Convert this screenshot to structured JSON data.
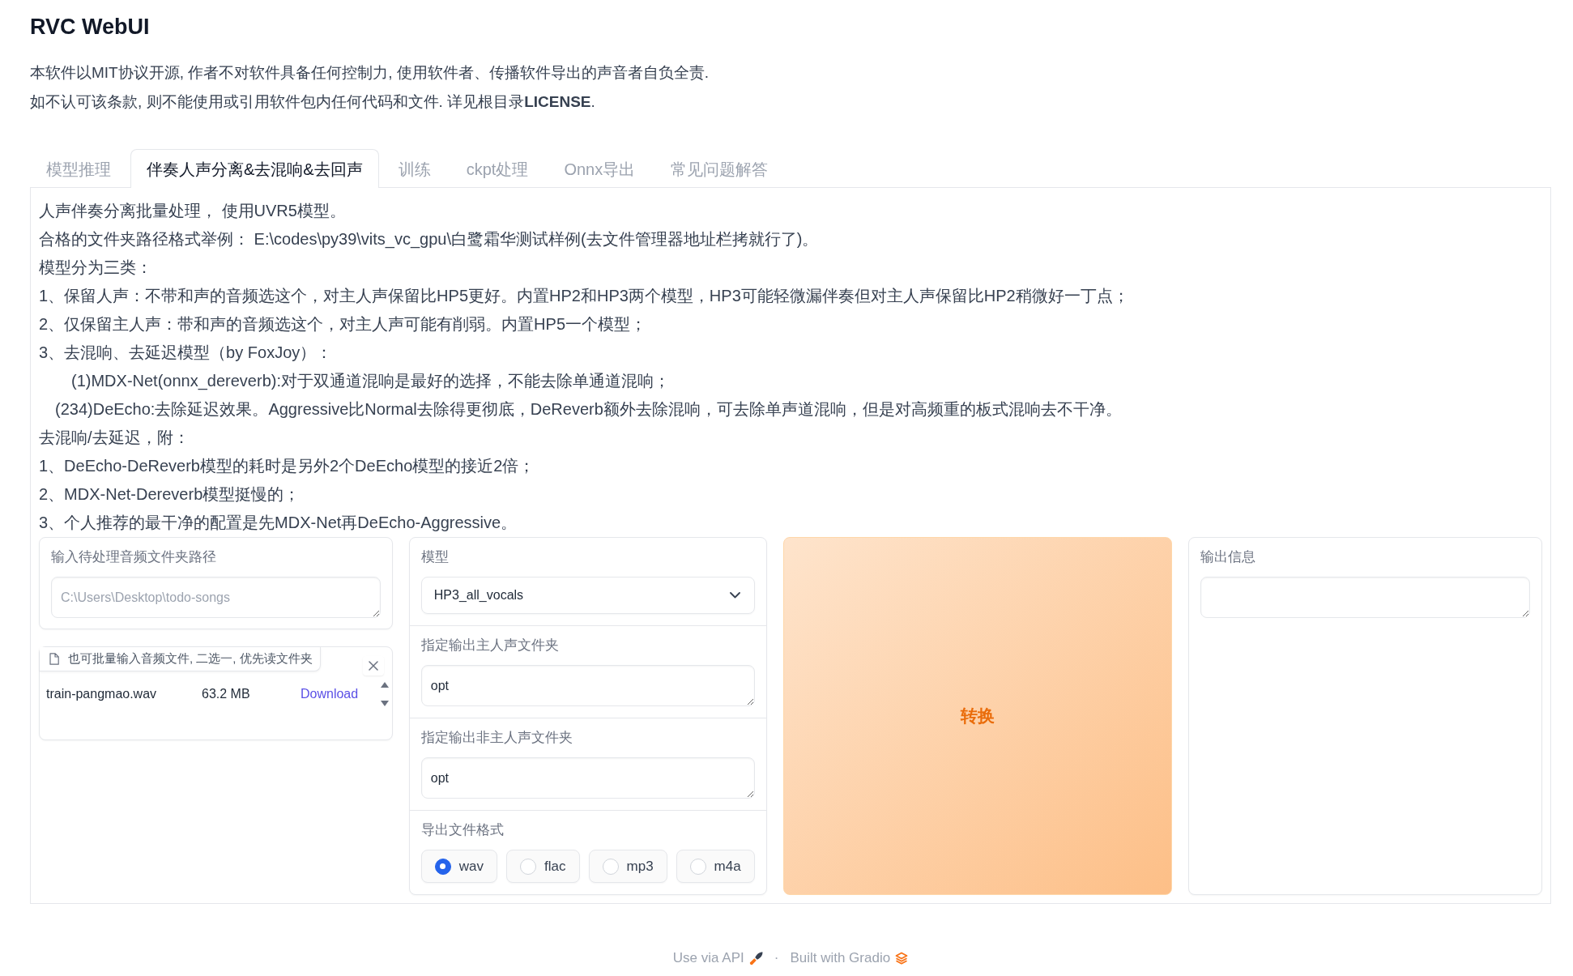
{
  "header": {
    "title": "RVC WebUI",
    "intro": [
      "本软件以MIT协议开源, 作者不对软件具备任何控制力, 使用软件者、传播软件导出的声音者自负全责.",
      "如不认可该条款, 则不能使用或引用软件包内任何代码和文件. 详见根目录**LICENSE**."
    ]
  },
  "tabs": [
    {
      "label": "模型推理",
      "selected": false
    },
    {
      "label": "伴奏人声分离&去混响&去回声",
      "selected": true
    },
    {
      "label": "训练",
      "selected": false
    },
    {
      "label": "ckpt处理",
      "selected": false
    },
    {
      "label": "Onnx导出",
      "selected": false
    },
    {
      "label": "常见问题解答",
      "selected": false
    }
  ],
  "instructions": [
    {
      "kind": "line",
      "text": "人声伴奏分离批量处理， 使用UVR5模型。"
    },
    {
      "kind": "line",
      "text": "合格的文件夹路径格式举例： E:\\codes\\py39\\vits_vc_gpu\\白鹭霜华测试样例(去文件管理器地址栏拷就行了)。"
    },
    {
      "kind": "line",
      "text": "模型分为三类："
    },
    {
      "kind": "line",
      "text": "1、保留人声：不带和声的音频选这个，对主人声保留比HP5更好。内置HP2和HP3两个模型，HP3可能轻微漏伴奏但对主人声保留比HP2稍微好一丁点；"
    },
    {
      "kind": "line",
      "text": "2、仅保留主人声：带和声的音频选这个，对主人声可能有削弱。内置HP5一个模型；"
    },
    {
      "kind": "line",
      "text": "3、去混响、去延迟模型（by FoxJoy）："
    },
    {
      "kind": "indent",
      "text": "(1)MDX-Net(onnx_dereverb):对于双通道混响是最好的选择，不能去除单通道混响；"
    },
    {
      "kind": "halfindent",
      "text": "(234)DeEcho:去除延迟效果。Aggressive比Normal去除得更彻底，DeReverb额外去除混响，可去除单声道混响，但是对高频重的板式混响去不干净。"
    },
    {
      "kind": "line",
      "text": "去混响/去延迟，附："
    },
    {
      "kind": "line",
      "text": "1、DeEcho-DeReverb模型的耗时是另外2个DeEcho模型的接近2倍；"
    },
    {
      "kind": "line",
      "text": "2、MDX-Net-Dereverb模型挺慢的；"
    },
    {
      "kind": "line",
      "text": "3、个人推荐的最干净的配置是先MDX-Net再DeEcho-Aggressive。"
    }
  ],
  "input_folder": {
    "label": "输入待处理音频文件夹路径",
    "placeholder": "C:\\Users\\Desktop\\todo-songs"
  },
  "file_upload": {
    "label": "也可批量输入音频文件, 二选一, 优先读文件夹",
    "files": [
      {
        "name": "train-pangmao.wav",
        "size": "63.2 MB",
        "action": "Download"
      }
    ]
  },
  "settings": {
    "model": {
      "label": "模型",
      "value": "HP3_all_vocals"
    },
    "vocals_folder": {
      "label": "指定输出主人声文件夹",
      "value": "opt"
    },
    "instrumental_folder": {
      "label": "指定输出非主人声文件夹",
      "value": "opt"
    },
    "format": {
      "label": "导出文件格式",
      "options": [
        {
          "label": "wav",
          "selected": true
        },
        {
          "label": "flac",
          "selected": false
        },
        {
          "label": "mp3",
          "selected": false
        },
        {
          "label": "m4a",
          "selected": false
        }
      ]
    }
  },
  "convert_button": {
    "label": "转换"
  },
  "output": {
    "label": "输出信息"
  },
  "footer": {
    "api_link": "Use via API",
    "separator": "·",
    "built_with": "Built with Gradio"
  }
}
